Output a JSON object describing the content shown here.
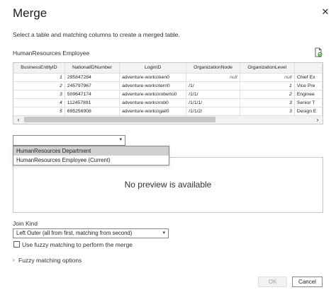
{
  "dialog": {
    "title": "Merge",
    "close_glyph": "✕",
    "subtitle": "Select a table and matching columns to create a merged table.",
    "table_name": "HumanResources Employee"
  },
  "grid": {
    "columns": [
      "BusinessEntityID",
      "NationalIDNumber",
      "LoginID",
      "OrganizationNode",
      "OrganizationLevel",
      ""
    ],
    "rows": [
      [
        "1",
        "295847284",
        "adventure-works\\ken0",
        "null",
        "null",
        "Chief Ex"
      ],
      [
        "2",
        "245797967",
        "adventure-works\\terri0",
        "/1/",
        "1",
        "Vice Pre"
      ],
      [
        "3",
        "509647174",
        "adventure-works\\roberto0",
        "/1/1/",
        "2",
        "Enginee"
      ],
      [
        "4",
        "112457891",
        "adventure-works\\rob0",
        "/1/1/1/",
        "3",
        "Senior T"
      ],
      [
        "5",
        "695256908",
        "adventure-works\\gail0",
        "/1/1/2/",
        "3",
        "Design E"
      ]
    ]
  },
  "scroll": {
    "left_glyph": "‹",
    "right_glyph": "›"
  },
  "second_table": {
    "selected_value": "",
    "chevron": "▾",
    "options": [
      "HumanResources Department",
      "HumanResources Employee (Current)"
    ]
  },
  "preview": {
    "empty_text": "No preview is available"
  },
  "join": {
    "label": "Join Kind",
    "value": "Left Outer (all from first, matching from second)",
    "chevron": "▾"
  },
  "fuzzy": {
    "checkbox_label": "Use fuzzy matching to perform the merge",
    "options_chevron": "›",
    "options_label": "Fuzzy matching options"
  },
  "buttons": {
    "ok": "OK",
    "cancel": "Cancel"
  },
  "colors": {
    "border": "#c8c6c4",
    "highlight": "#d2d0ce",
    "disabled_text": "#a19f9d"
  }
}
